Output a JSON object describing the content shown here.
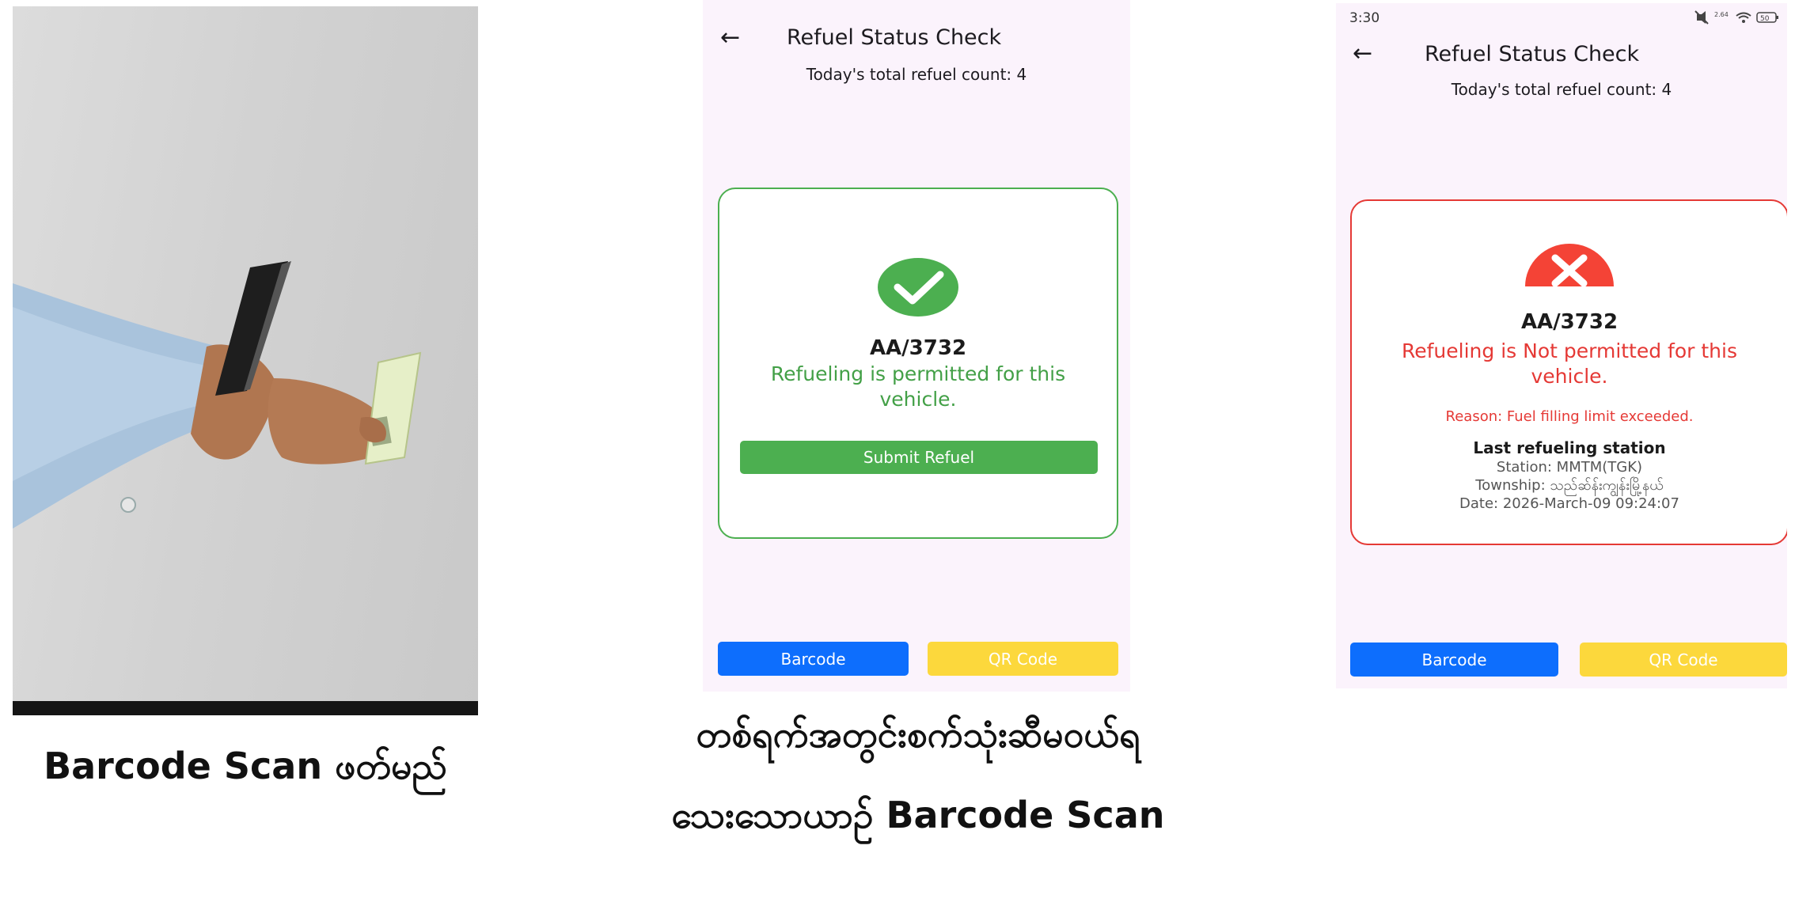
{
  "captions": {
    "left": "Barcode Scan ဖတ်မည်",
    "middle_line1": "တစ်ရက်အတွင်းစက်သုံးဆီမဝယ်ရ",
    "middle_line2": "သေးသောယာဥ် Barcode  Scan"
  },
  "screen_permitted": {
    "app_bar": {
      "title": "Refuel Status Check",
      "back_icon": "arrow-left-icon"
    },
    "total_count_text": "Today's total refuel count: 4",
    "result": {
      "status": "permitted",
      "icon": "check-circle-icon",
      "plate": "AA/3732",
      "message": "Refueling is permitted for this vehicle.",
      "submit_label": "Submit Refuel"
    },
    "bottom_buttons": {
      "barcode": "Barcode",
      "qr": "QR Code"
    },
    "colors": {
      "accent": "#4caf50"
    }
  },
  "screen_denied": {
    "status_bar": {
      "time": "3:30",
      "icons": [
        "mute-icon",
        "network-speed-icon",
        "wifi-icon",
        "battery-icon"
      ],
      "network_speed": "2.64",
      "battery": "50"
    },
    "app_bar": {
      "title": "Refuel Status Check",
      "back_icon": "arrow-left-icon"
    },
    "total_count_text": "Today's total refuel count: 4",
    "result": {
      "status": "not-permitted",
      "icon": "x-circle-icon",
      "plate": "AA/3732",
      "message": "Refueling is Not permitted for this vehicle.",
      "reason": "Reason: Fuel filling limit exceeded.",
      "last_station_title": "Last refueling station",
      "station": "Station: MMTM(TGK)",
      "township": "Township: သည်ဆ်န်းကျွန်းမြို့နယ်",
      "date": "Date: 2026-March-09 09:24:07"
    },
    "bottom_buttons": {
      "barcode": "Barcode",
      "qr": "QR Code"
    },
    "colors": {
      "accent": "#e53935",
      "barcode_button": "#0d6efd",
      "qr_button": "#fcd83c"
    }
  }
}
